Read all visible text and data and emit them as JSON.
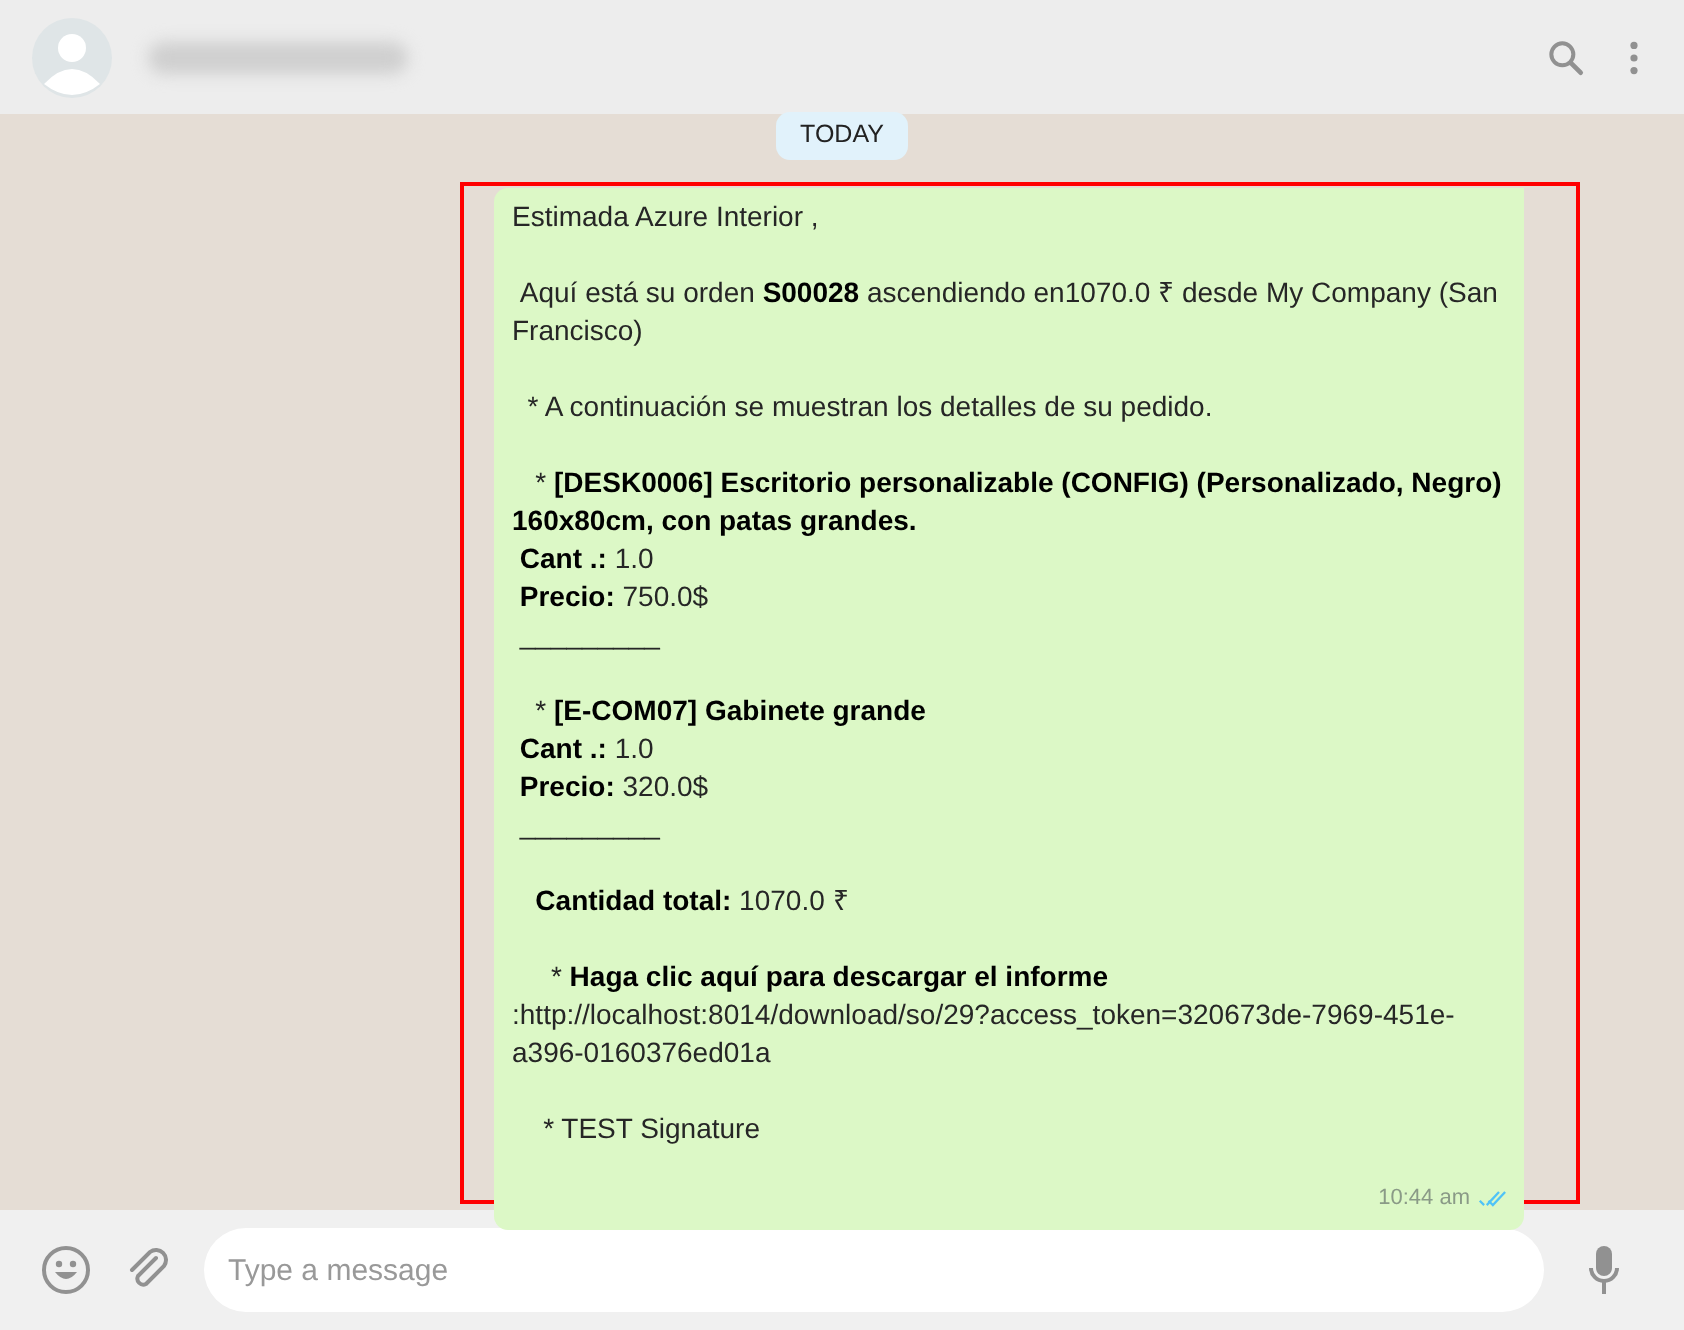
{
  "date_badge": "TODAY",
  "message": {
    "paragraphs": [
      [
        "Estimada Azure Interior ,"
      ],
      [
        " Aquí está su orden **S00028** ascendiendo en1070.0 ₹ desde My Company (San Francisco)"
      ],
      [
        "  * A continuación se muestran los detalles de su pedido."
      ],
      [
        "   * **[DESK0006] Escritorio personalizable (CONFIG) (Personalizado, Negro) 160x80cm, con patas grandes.**",
        " **Cant .:** 1.0",
        " **Precio:** 750.0$",
        " _________"
      ],
      [
        "   * **[E-COM07] Gabinete grande**",
        " **Cant .:** 1.0",
        " **Precio:** 320.0$",
        " _________"
      ],
      [
        "   **Cantidad total:** 1070.0 ₹"
      ],
      [
        "     * **Haga clic aquí para descargar el informe**",
        ":http://localhost:8014/download/so/29?access_token=320673de-7969-451e-a396-0160376ed01a"
      ],
      [
        "    * TEST Signature"
      ]
    ],
    "time": "10:44 am",
    "read": true
  },
  "composer": {
    "placeholder": "Type a message"
  }
}
